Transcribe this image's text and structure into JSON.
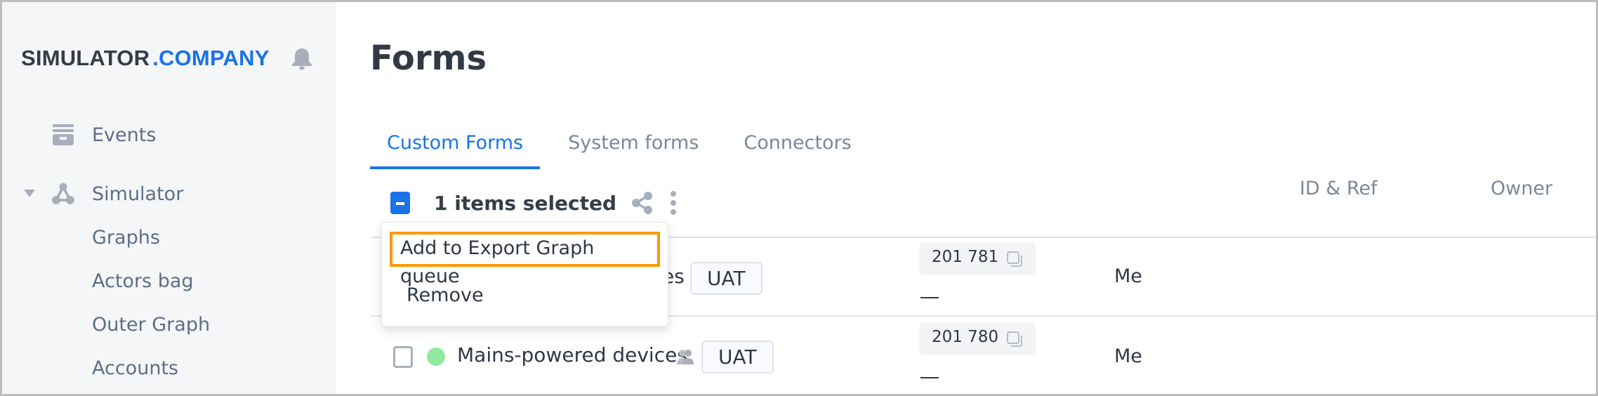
{
  "brand": {
    "name_part1": "SIMULATOR",
    "name_part2": ".COMPANY",
    "accent_color": "#1a73e8"
  },
  "sidebar": {
    "items": [
      {
        "label": "Events",
        "icon": "archive-icon"
      },
      {
        "label": "Simulator",
        "icon": "graph-nodes-icon",
        "expanded": true,
        "children": [
          {
            "label": "Graphs"
          },
          {
            "label": "Actors bag"
          },
          {
            "label": "Outer Graph"
          },
          {
            "label": "Accounts"
          }
        ]
      }
    ],
    "notification_icon": "bell-icon"
  },
  "page": {
    "title": "Forms"
  },
  "tabs": [
    {
      "label": "Custom Forms",
      "active": true
    },
    {
      "label": "System forms",
      "active": false
    },
    {
      "label": "Connectors",
      "active": false
    }
  ],
  "selection": {
    "text": "1 items selected",
    "share_icon": "share-icon",
    "more_icon": "kebab-menu-icon"
  },
  "columns": {
    "id_ref": "ID & Ref",
    "owner": "Owner"
  },
  "rows": [
    {
      "name_visible_suffix": "es",
      "tag": "UAT",
      "id": "201 781",
      "ref": "—",
      "owner": "Me",
      "checked": true
    },
    {
      "name": "Mains-powered devices",
      "status_color": "#8fe9a0",
      "shared_icon": "people-icon",
      "tag": "UAT",
      "id": "201 780",
      "ref": "—",
      "owner": "Me",
      "checked": false
    }
  ],
  "menu": {
    "items": [
      {
        "label": "Add to Export Graph queue",
        "highlighted": true
      },
      {
        "label": "Remove"
      }
    ],
    "highlight_color": "#ff9800"
  }
}
